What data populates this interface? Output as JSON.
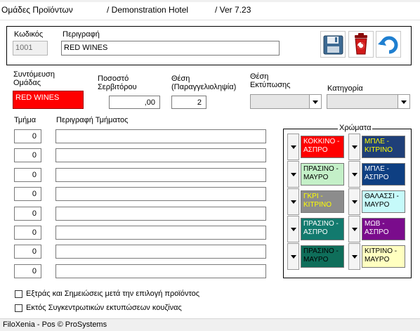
{
  "header": {
    "title": "Ομάδες Προϊόντων",
    "hotel": "/ Demonstration Hotel",
    "version": "/  Ver  7.23"
  },
  "top": {
    "code_label": "Κωδικός",
    "code_value": "1001",
    "description_label": "Περιγραφή",
    "description_value": "RED WINES",
    "icons": [
      "save-icon",
      "delete-icon",
      "undo-icon"
    ]
  },
  "group": {
    "short_label": "Συντόμευση Ομάδας",
    "short_value": "RED WINES",
    "waiter_pct_label": "Ποσοστό Σερβιτόρου",
    "waiter_pct_value": ",00",
    "position_label": "Θέση (Παραγγελιοληψία)",
    "position_value": "2",
    "print_position_label": "Θέση Εκτύπωσης",
    "print_position_value": "",
    "category_label": "Κατηγορία",
    "category_value": ""
  },
  "sections": {
    "num_label": "Τμήμα",
    "desc_label": "Περιγραφή Τμήματος",
    "rows": [
      {
        "num": "0",
        "desc": ""
      },
      {
        "num": "0",
        "desc": ""
      },
      {
        "num": "0",
        "desc": ""
      },
      {
        "num": "0",
        "desc": ""
      },
      {
        "num": "0",
        "desc": ""
      },
      {
        "num": "0",
        "desc": ""
      },
      {
        "num": "0",
        "desc": ""
      },
      {
        "num": "0",
        "desc": ""
      }
    ]
  },
  "colors": {
    "legend": "Χρώματα",
    "swatches": [
      {
        "label": "ΚΟΚΚΙΝΟ - ΑΣΠΡΟ",
        "bg": "#ff0000",
        "fg": "#ffffff"
      },
      {
        "label": "ΜΠΛΕ - ΚΙΤΡΙΝΟ",
        "bg": "#1f3f78",
        "fg": "#ffff00"
      },
      {
        "label": "ΠΡΑΣΙΝΟ - ΜΑΥΡΟ",
        "bg": "#c4f0c8",
        "fg": "#000000"
      },
      {
        "label": "ΜΠΛΕ - ΑΣΠΡΟ",
        "bg": "#0e3f82",
        "fg": "#ffffff"
      },
      {
        "label": "ΓΚΡΙ - ΚΙΤΡΙΝΟ",
        "bg": "#8c8c8c",
        "fg": "#ffff00"
      },
      {
        "label": "ΘΑΛΑΣΣΙ - ΜΑΥΡΟ",
        "bg": "#c6fafa",
        "fg": "#000000"
      },
      {
        "label": "ΠΡΑΣΙΝΟ - ΑΣΠΡΟ",
        "bg": "#127a6e",
        "fg": "#ffffff"
      },
      {
        "label": "ΜΩΒ - ΑΣΠΡΟ",
        "bg": "#7a0c8c",
        "fg": "#ffffff"
      },
      {
        "label": "ΠΡΑΣΙΝΟ - ΜΑΥΡΟ",
        "bg": "#0f6e5a",
        "fg": "#000000"
      },
      {
        "label": "ΚΙΤΡΙΝΟ - ΜΑΥΡΟ",
        "bg": "#ffffc0",
        "fg": "#000000"
      }
    ]
  },
  "options": {
    "extras_label": "Εξτράς και Σημειώσεις μετά την επιλογή προϊόντος",
    "extras_checked": false,
    "kitchen_label": "Εκτός Συγκεντρωτικών εκτυπώσεων κουζίνας",
    "kitchen_checked": false
  },
  "status": {
    "text": "FiloXenia - Pos  © ProSystems"
  }
}
